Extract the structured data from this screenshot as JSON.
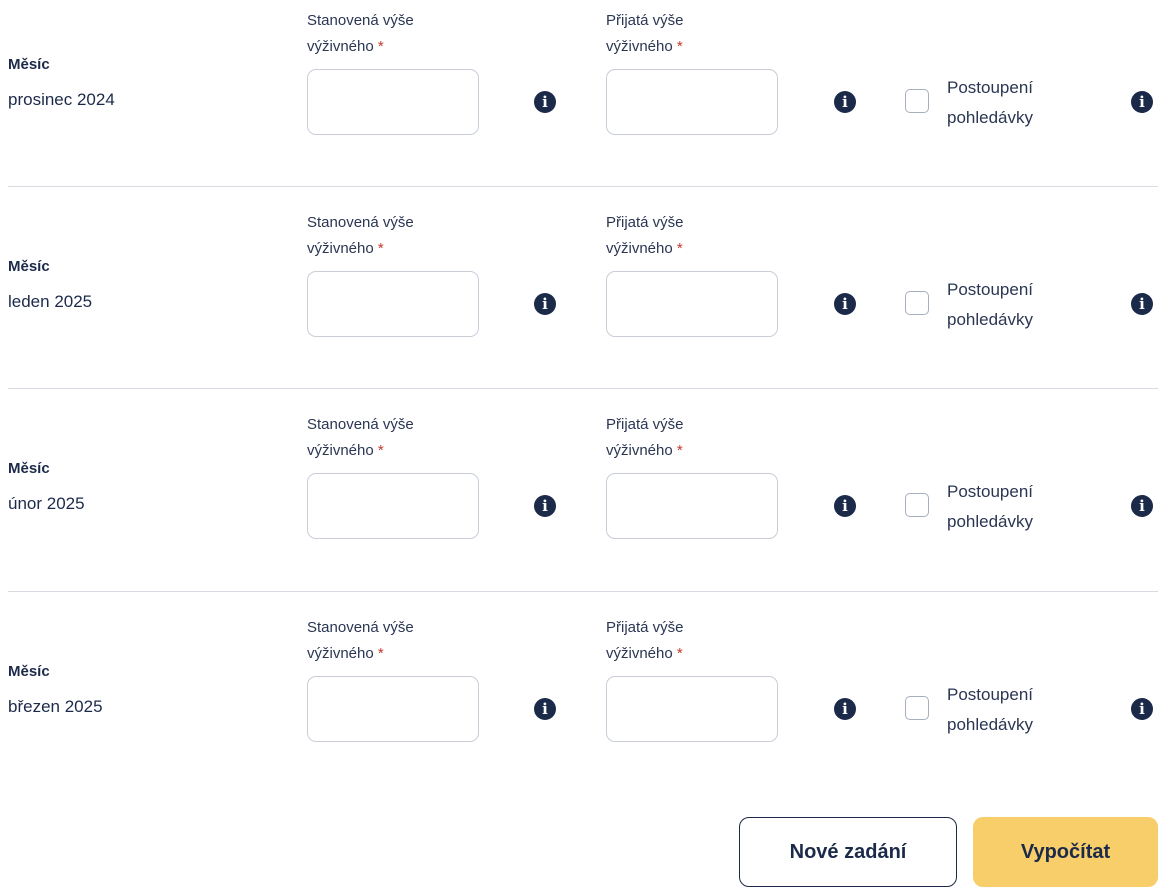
{
  "rows": [
    {
      "month_label": "Měsíc",
      "month_value": "prosinec 2024",
      "set_amount_label": "Stanovená výše",
      "set_amount_label2": "výživného",
      "received_amount_label": "Přijatá výše",
      "received_amount_label2": "výživného",
      "required_marker": "*",
      "set_amount_value": "",
      "received_amount_value": "",
      "assignment_label_line1": "Postoupení",
      "assignment_label_line2": "pohledávky",
      "assignment_checked": false
    },
    {
      "month_label": "Měsíc",
      "month_value": "leden 2025",
      "set_amount_label": "Stanovená výše",
      "set_amount_label2": "výživného",
      "received_amount_label": "Přijatá výše",
      "received_amount_label2": "výživného",
      "required_marker": "*",
      "set_amount_value": "",
      "received_amount_value": "",
      "assignment_label_line1": "Postoupení",
      "assignment_label_line2": "pohledávky",
      "assignment_checked": false
    },
    {
      "month_label": "Měsíc",
      "month_value": "únor 2025",
      "set_amount_label": "Stanovená výše",
      "set_amount_label2": "výživného",
      "received_amount_label": "Přijatá výše",
      "received_amount_label2": "výživného",
      "required_marker": "*",
      "set_amount_value": "",
      "received_amount_value": "",
      "assignment_label_line1": "Postoupení",
      "assignment_label_line2": "pohledávky",
      "assignment_checked": false
    },
    {
      "month_label": "Měsíc",
      "month_value": "březen 2025",
      "set_amount_label": "Stanovená výše",
      "set_amount_label2": "výživného",
      "received_amount_label": "Přijatá výše",
      "received_amount_label2": "výživného",
      "required_marker": "*",
      "set_amount_value": "",
      "received_amount_value": "",
      "assignment_label_line1": "Postoupení",
      "assignment_label_line2": "pohledávky",
      "assignment_checked": false
    }
  ],
  "info_icon": "info-circle-icon",
  "actions": {
    "new_entry_label": "Nové zadání",
    "calculate_label": "Vypočítat"
  },
  "colors": {
    "text": "#1c2a4a",
    "required": "#c0392b",
    "primary_button": "#f7ce6a",
    "border": "#c8cdd8"
  }
}
